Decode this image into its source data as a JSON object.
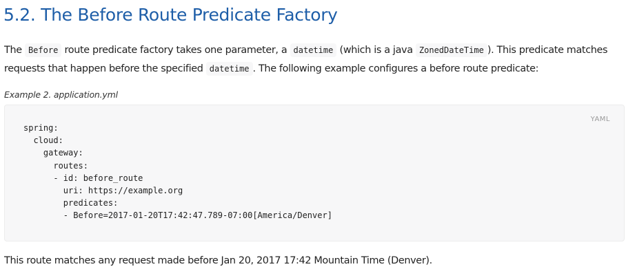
{
  "heading": "5.2. The Before Route Predicate Factory",
  "intro": {
    "t1": "The ",
    "c1": "Before",
    "t2": " route predicate factory takes one parameter, a ",
    "c2": "datetime",
    "t3": " (which is a java ",
    "c3": "ZonedDateTime",
    "t4": "). This predicate matches requests that happen before the specified ",
    "c4": "datetime",
    "t5": ". The following example configures a before route predicate:"
  },
  "example": {
    "title": "Example 2. application.yml",
    "language": "YAML",
    "code": "spring:\n  cloud:\n    gateway:\n      routes:\n      - id: before_route\n        uri: https://example.org\n        predicates:\n        - Before=2017-01-20T17:42:47.789-07:00[America/Denver]"
  },
  "footer": "This route matches any request made before Jan 20, 2017 17:42 Mountain Time (Denver)."
}
